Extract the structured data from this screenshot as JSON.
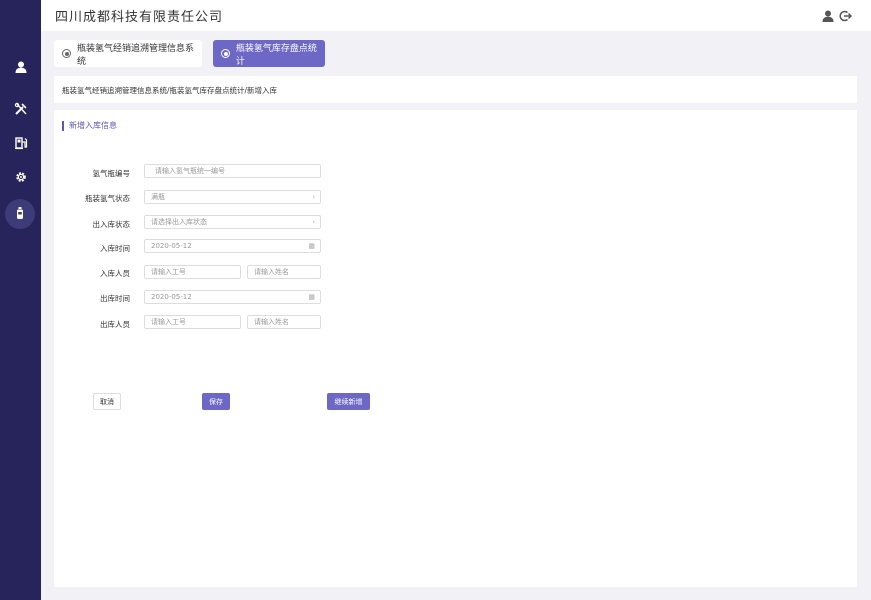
{
  "app": {
    "company": "四川成都科技有限责任公司"
  },
  "icons": {
    "sidebar": [
      "user-icon",
      "tools-icon",
      "fuel-station-icon",
      "gear-icon",
      "cylinder-icon"
    ],
    "top": [
      "user-icon",
      "logout-icon"
    ]
  },
  "tabs": [
    {
      "label": "瓶装氢气经销追溯管理信息系统",
      "active": false
    },
    {
      "label": "瓶装氢气库存盘点统计",
      "active": true
    }
  ],
  "breadcrumb": "瓶装氢气经销追溯管理信息系统/瓶装氢气库存盘点统计/新增入库",
  "form": {
    "title": "新增入库信息",
    "cylinder_no": {
      "label": "氢气瓶编号",
      "placeholder": "请输入氢气瓶统一编号"
    },
    "cylinder_status": {
      "label": "瓶装氢气状态",
      "value": "满瓶"
    },
    "io_status": {
      "label": "出入库状态",
      "placeholder": "请选择出入库状态"
    },
    "in_time": {
      "label": "入库时间",
      "value": "2020-05-12"
    },
    "in_person": {
      "label": "入库人员",
      "id_placeholder": "请输入工号",
      "name_placeholder": "请输入姓名"
    },
    "out_time": {
      "label": "出库时间",
      "value": "2020-05-12"
    },
    "out_person": {
      "label": "出库人员",
      "id_placeholder": "请输入工号",
      "name_placeholder": "请输入姓名"
    }
  },
  "buttons": {
    "cancel": "取消",
    "save": "保存",
    "continue": "继续新增"
  },
  "colors": {
    "sidebar": "#26245a",
    "accent": "#6d67c6"
  }
}
